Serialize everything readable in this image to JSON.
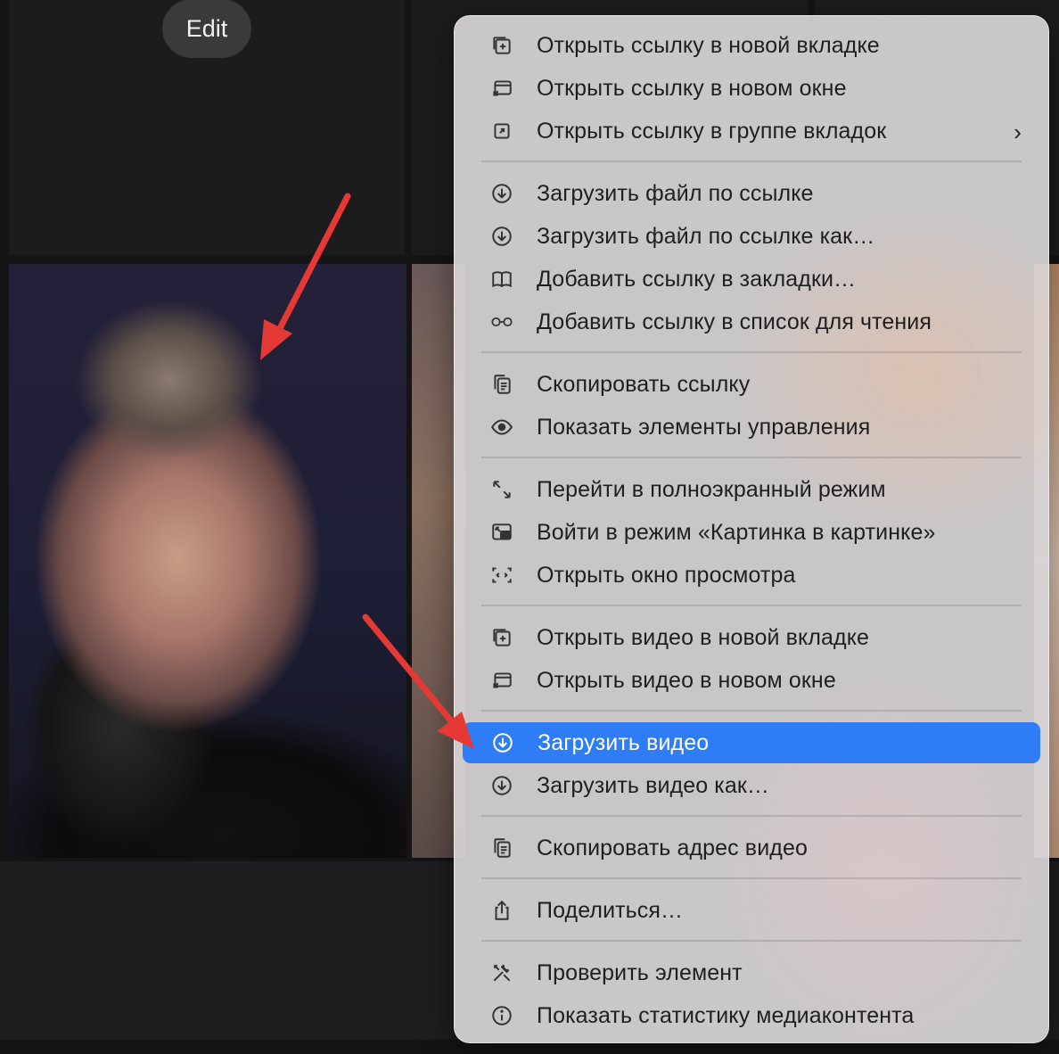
{
  "background": {
    "edit_button": "Edit"
  },
  "colors": {
    "highlight": "#2e7cf6",
    "arrow": "#e53935",
    "menu_text": "#1f1f1f"
  },
  "menu": {
    "groups": [
      [
        {
          "label": "Открыть ссылку в новой вкладке",
          "icon": "new-tab-icon"
        },
        {
          "label": "Открыть ссылку в новом окне",
          "icon": "new-window-icon"
        },
        {
          "label": "Открыть ссылку в группе вкладок",
          "icon": "tab-group-icon",
          "submenu": true
        }
      ],
      [
        {
          "label": "Загрузить файл по ссылке",
          "icon": "download-icon"
        },
        {
          "label": "Загрузить файл по ссылке как…",
          "icon": "download-icon"
        },
        {
          "label": "Добавить ссылку в закладки…",
          "icon": "book-icon"
        },
        {
          "label": "Добавить ссылку в список для чтения",
          "icon": "glasses-icon"
        }
      ],
      [
        {
          "label": "Скопировать ссылку",
          "icon": "copy-icon"
        },
        {
          "label": "Показать элементы управления",
          "icon": "eye-icon"
        }
      ],
      [
        {
          "label": "Перейти в полноэкранный режим",
          "icon": "fullscreen-icon"
        },
        {
          "label": "Войти в режим «Картинка в картинке»",
          "icon": "pip-icon"
        },
        {
          "label": "Открыть окно просмотра",
          "icon": "viewer-window-icon"
        }
      ],
      [
        {
          "label": "Открыть видео в новой вкладке",
          "icon": "new-tab-icon"
        },
        {
          "label": "Открыть видео в новом окне",
          "icon": "new-window-icon"
        }
      ],
      [
        {
          "label": "Загрузить видео",
          "icon": "download-icon",
          "selected": true
        },
        {
          "label": "Загрузить видео как…",
          "icon": "download-icon"
        }
      ],
      [
        {
          "label": "Скопировать адрес видео",
          "icon": "copy-icon"
        }
      ],
      [
        {
          "label": "Поделиться…",
          "icon": "share-icon"
        }
      ],
      [
        {
          "label": "Проверить элемент",
          "icon": "tools-icon"
        },
        {
          "label": "Показать статистику медиаконтента",
          "icon": "info-icon"
        }
      ]
    ]
  }
}
